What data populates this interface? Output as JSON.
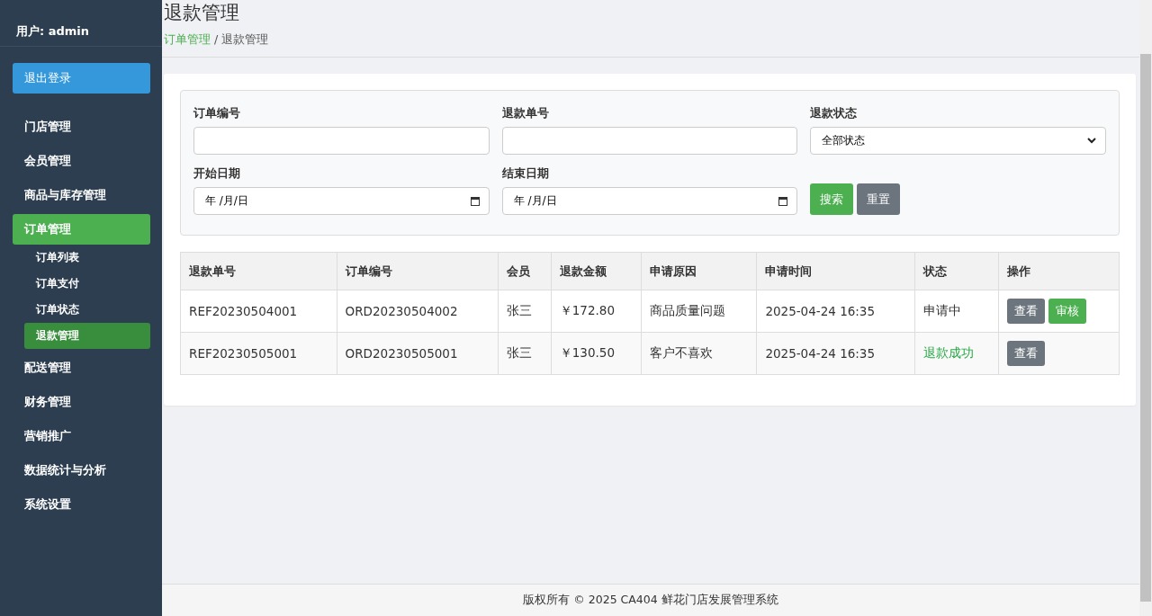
{
  "sidebar": {
    "user": "用户: admin",
    "logout": "退出登录",
    "items": [
      {
        "label": "门店管理",
        "selected": false
      },
      {
        "label": "会员管理",
        "selected": false
      },
      {
        "label": "商品与库存管理",
        "selected": false
      },
      {
        "label": "订单管理",
        "selected": true,
        "children": [
          {
            "label": "订单列表",
            "selected": false
          },
          {
            "label": "订单支付",
            "selected": false
          },
          {
            "label": "订单状态",
            "selected": false
          },
          {
            "label": "退款管理",
            "selected": true
          }
        ]
      },
      {
        "label": "配送管理",
        "selected": false
      },
      {
        "label": "财务管理",
        "selected": false
      },
      {
        "label": "营销推广",
        "selected": false
      },
      {
        "label": "数据统计与分析",
        "selected": false
      },
      {
        "label": "系统设置",
        "selected": false
      }
    ]
  },
  "header": {
    "title": "退款管理",
    "breadcrumb": [
      {
        "label": "订单管理",
        "kind": "link"
      },
      {
        "label": "退款管理",
        "kind": "current"
      }
    ],
    "separator": "/"
  },
  "filters": [
    {
      "label": "订单编号",
      "kind": "text"
    },
    {
      "label": "退款单号",
      "kind": "text"
    },
    {
      "label": "退款状态",
      "kind": "select",
      "value": "全部状态"
    },
    {
      "label": "开始日期",
      "kind": "date",
      "value": "年 /月/日"
    },
    {
      "label": "结束日期",
      "kind": "date",
      "value": "年 /月/日"
    }
  ],
  "filter_buttons": [
    {
      "label": "搜索",
      "kind": "primary"
    },
    {
      "label": "重置",
      "kind": "secondary"
    }
  ],
  "table": {
    "columns": [
      "退款单号",
      "订单编号",
      "会员",
      "退款金额",
      "申请原因",
      "申请时间",
      "状态",
      "操作"
    ],
    "rows": [
      {
        "cells": [
          "REF20230504001",
          "ORD20230504002",
          "张三",
          "￥172.80",
          "商品质量问题",
          "2025-04-24 16:35"
        ],
        "status": {
          "label": "申请中",
          "kind": "pending"
        },
        "actions": [
          {
            "label": "查看",
            "kind": "secondary"
          },
          {
            "label": "审核",
            "kind": "primary"
          }
        ]
      },
      {
        "cells": [
          "REF20230505001",
          "ORD20230505001",
          "张三",
          "￥130.50",
          "客户不喜欢",
          "2025-04-24 16:35"
        ],
        "status": {
          "label": "退款成功",
          "kind": "success"
        },
        "actions": [
          {
            "label": "查看",
            "kind": "secondary"
          }
        ]
      }
    ]
  },
  "footer": "版权所有 © 2025 CA404 鲜花门店发展管理系统"
}
